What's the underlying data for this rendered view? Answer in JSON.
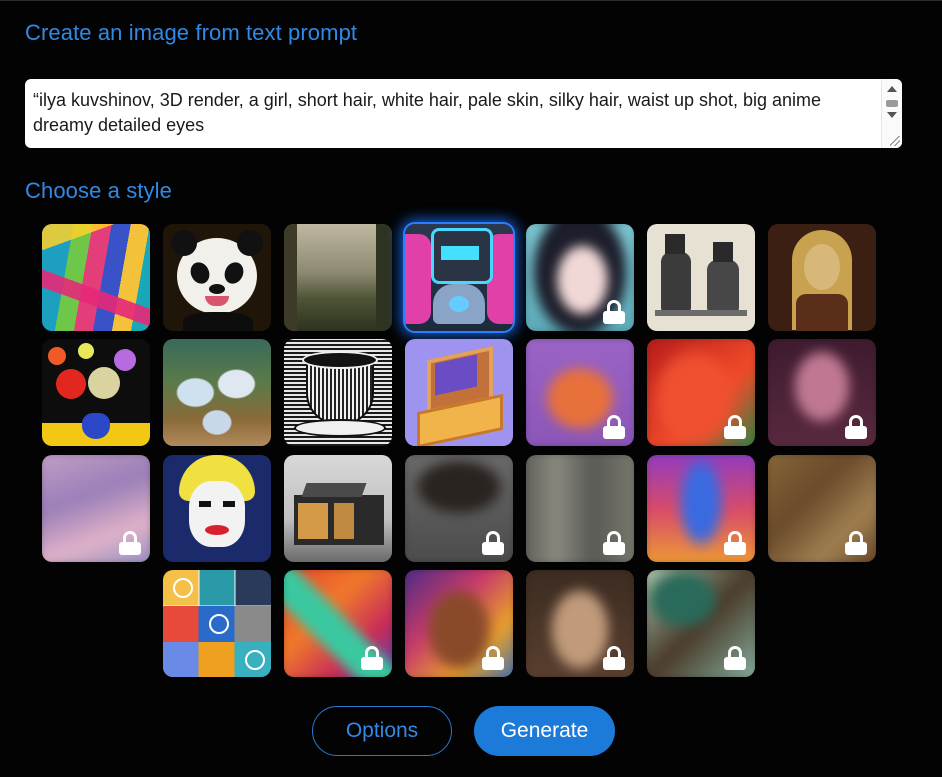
{
  "create_heading": "Create an image from text prompt",
  "prompt": {
    "value": "“ilya kuvshinov, 3D render, a girl, short hair, white hair, pale skin, silky hair, waist up shot, big anime dreamy detailed eyes"
  },
  "style_heading": "Choose a style",
  "styles": [
    {
      "name": "abstract-colorful-paint",
      "locked": false,
      "selected": false
    },
    {
      "name": "panda-portrait",
      "locked": false,
      "selected": false
    },
    {
      "name": "misty-forest-landscape",
      "locked": false,
      "selected": false
    },
    {
      "name": "neon-robot",
      "locked": false,
      "selected": true
    },
    {
      "name": "anime-woman-portrait",
      "locked": true,
      "selected": false
    },
    {
      "name": "victorian-sketch",
      "locked": false,
      "selected": false
    },
    {
      "name": "renaissance-portrait",
      "locked": false,
      "selected": false
    },
    {
      "name": "flower-vase-painting",
      "locked": false,
      "selected": false
    },
    {
      "name": "ballet-dancers-painting",
      "locked": false,
      "selected": false
    },
    {
      "name": "woodcut-cup",
      "locked": false,
      "selected": false
    },
    {
      "name": "isometric-computer",
      "locked": false,
      "selected": false
    },
    {
      "name": "low-poly-fox",
      "locked": true,
      "selected": false
    },
    {
      "name": "neon-glowing-face",
      "locked": true,
      "selected": false
    },
    {
      "name": "pink-woman-portrait",
      "locked": true,
      "selected": false
    },
    {
      "name": "pastel-clouds",
      "locked": true,
      "selected": false
    },
    {
      "name": "pop-art-portrait",
      "locked": false,
      "selected": false
    },
    {
      "name": "modern-architecture",
      "locked": false,
      "selected": false
    },
    {
      "name": "dark-rock",
      "locked": true,
      "selected": false
    },
    {
      "name": "grey-interior",
      "locked": true,
      "selected": false
    },
    {
      "name": "psychedelic-rabbit",
      "locked": true,
      "selected": false
    },
    {
      "name": "sepia-painting",
      "locked": true,
      "selected": false
    },
    {
      "name": "icon-grid",
      "locked": false,
      "selected": false
    },
    {
      "name": "colorful-dragon",
      "locked": true,
      "selected": false
    },
    {
      "name": "mosaic-face",
      "locked": true,
      "selected": false
    },
    {
      "name": "fantasy-face",
      "locked": true,
      "selected": false
    },
    {
      "name": "teal-tree-painting",
      "locked": true,
      "selected": false
    }
  ],
  "buttons": {
    "options_label": "Options",
    "generate_label": "Generate"
  },
  "colors": {
    "accent": "#2f8ae6",
    "generate_button": "#1c7ad8",
    "background": "#030303",
    "selected_glow": "#1565e0"
  }
}
